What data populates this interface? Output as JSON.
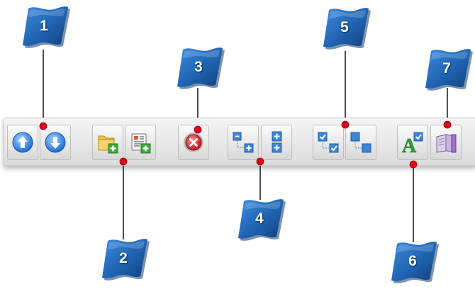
{
  "colors": {
    "flag_fill": "#1f63b0",
    "flag_shadow": "#0c3a70",
    "leader_dot": "#e0001b",
    "leader_line": "#222222",
    "toolbar_bg": "#e6e6e6"
  },
  "callouts": [
    {
      "label": "1"
    },
    {
      "label": "2"
    },
    {
      "label": "3"
    },
    {
      "label": "4"
    },
    {
      "label": "5"
    },
    {
      "label": "6"
    },
    {
      "label": "7"
    }
  ],
  "toolbar": {
    "buttons": [
      {
        "icon": "move-up-icon"
      },
      {
        "icon": "move-down-icon"
      },
      {
        "icon": "add-folder-icon"
      },
      {
        "icon": "add-item-icon"
      },
      {
        "icon": "delete-icon"
      },
      {
        "icon": "collapse-all-icon"
      },
      {
        "icon": "expand-all-icon"
      },
      {
        "icon": "check-all-icon"
      },
      {
        "icon": "uncheck-all-icon"
      },
      {
        "icon": "font-style-icon"
      },
      {
        "icon": "book-icon"
      }
    ]
  }
}
